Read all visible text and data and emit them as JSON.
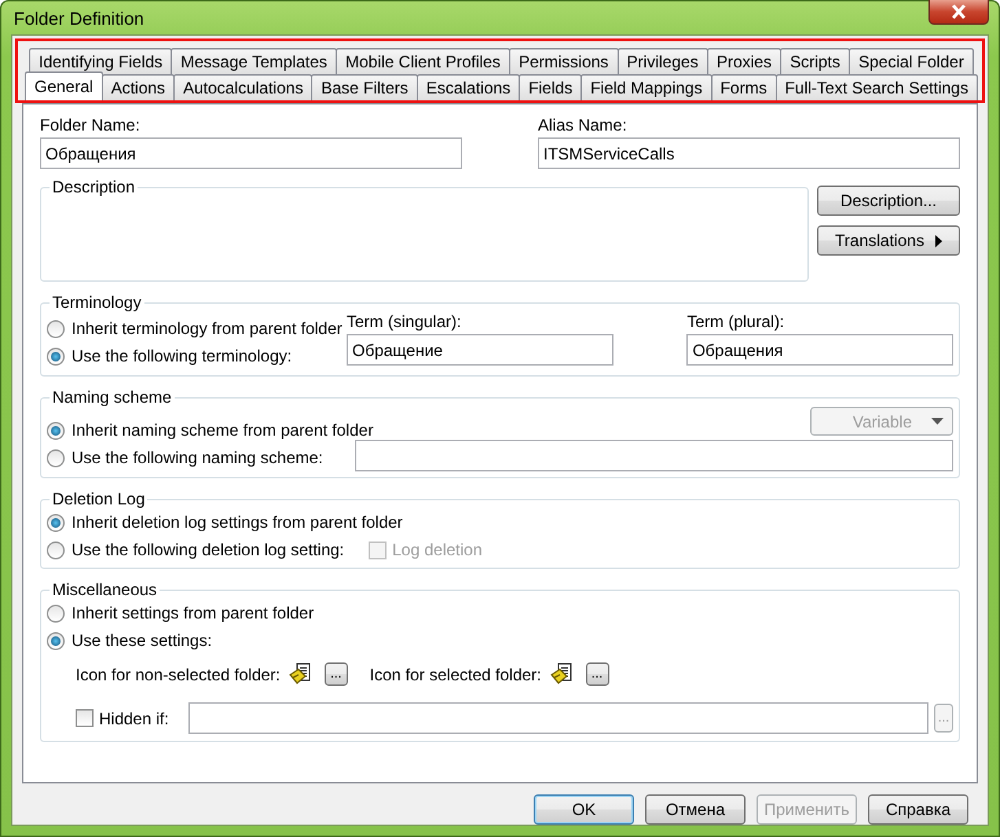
{
  "window": {
    "title": "Folder Definition"
  },
  "tab_rows": [
    {
      "tabs": [
        {
          "label": "Identifying Fields",
          "selected": false
        },
        {
          "label": "Message Templates",
          "selected": false
        },
        {
          "label": "Mobile Client Profiles",
          "selected": false
        },
        {
          "label": "Permissions",
          "selected": false
        },
        {
          "label": "Privileges",
          "selected": false
        },
        {
          "label": "Proxies",
          "selected": false
        },
        {
          "label": "Scripts",
          "selected": false
        },
        {
          "label": "Special Folder",
          "selected": false
        }
      ]
    },
    {
      "tabs": [
        {
          "label": "General",
          "selected": true
        },
        {
          "label": "Actions",
          "selected": false
        },
        {
          "label": "Autocalculations",
          "selected": false
        },
        {
          "label": "Base Filters",
          "selected": false
        },
        {
          "label": "Escalations",
          "selected": false
        },
        {
          "label": "Fields",
          "selected": false
        },
        {
          "label": "Field Mappings",
          "selected": false
        },
        {
          "label": "Forms",
          "selected": false
        },
        {
          "label": "Full-Text Search Settings",
          "selected": false
        }
      ]
    }
  ],
  "folder_name": {
    "label": "Folder Name:",
    "value": "Обращения"
  },
  "alias_name": {
    "label": "Alias Name:",
    "value": "ITSMServiceCalls"
  },
  "description": {
    "title": "Description",
    "buttons": [
      {
        "label": "Description...",
        "kind": "plain"
      },
      {
        "label": "Translations",
        "kind": "menu"
      }
    ]
  },
  "terminology": {
    "title": "Terminology",
    "options": [
      {
        "label": "Inherit terminology from parent folder",
        "selected": false
      },
      {
        "label": "Use the following terminology:",
        "selected": true
      }
    ],
    "singular": {
      "label": "Term (singular):",
      "value": "Обращение"
    },
    "plural": {
      "label": "Term (plural):",
      "value": "Обращения"
    }
  },
  "naming_scheme": {
    "title": "Naming scheme",
    "options": [
      {
        "label": "Inherit naming scheme from parent folder",
        "selected": true
      },
      {
        "label": "Use the following naming scheme:",
        "selected": false
      }
    ],
    "dropdown": {
      "value": "Variable",
      "disabled": true
    }
  },
  "deletion_log": {
    "title": "Deletion Log",
    "options": [
      {
        "label": "Inherit deletion log settings from parent folder",
        "selected": true
      },
      {
        "label": "Use the following deletion log setting:",
        "selected": false
      }
    ],
    "log_deletion": {
      "label": "Log deletion",
      "checked": false,
      "disabled": true
    }
  },
  "miscellaneous": {
    "title": "Miscellaneous",
    "options": [
      {
        "label": "Inherit settings from parent folder",
        "selected": false
      },
      {
        "label": "Use these settings:",
        "selected": true
      }
    ],
    "icons": [
      {
        "label": "Icon for non-selected folder:",
        "browse": "..."
      },
      {
        "label": "Icon for selected folder:",
        "browse": "..."
      }
    ],
    "hidden_if": {
      "label": "Hidden if:",
      "checked": false,
      "browse": "...",
      "browse_disabled": true
    }
  },
  "buttons": [
    {
      "label": "OK",
      "default": true,
      "disabled": false
    },
    {
      "label": "Отмена",
      "default": false,
      "disabled": false
    },
    {
      "label": "Применить",
      "default": false,
      "disabled": true
    },
    {
      "label": "Справка",
      "default": false,
      "disabled": false
    }
  ]
}
